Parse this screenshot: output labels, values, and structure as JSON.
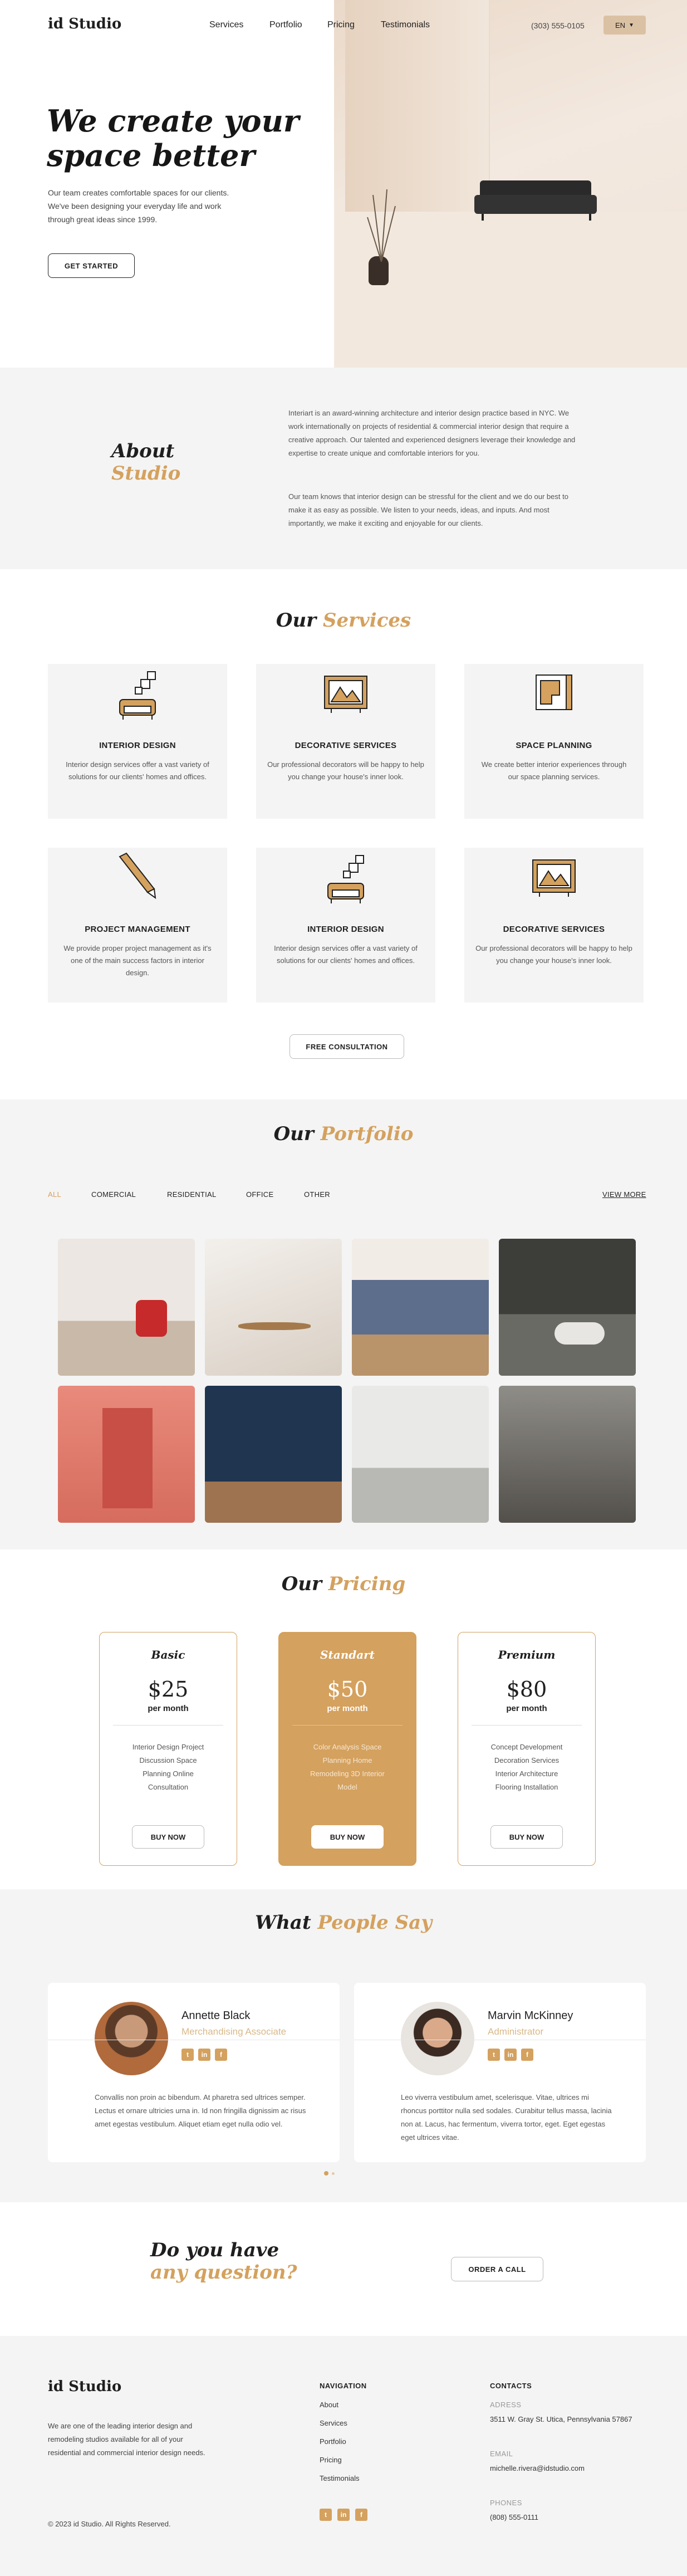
{
  "header": {
    "logo": "id Studio",
    "nav": [
      "Services",
      "Portfolio",
      "Pricing",
      "Testimonials"
    ],
    "phone": "(303) 555-0105",
    "lang": "EN"
  },
  "hero": {
    "title_line1": "We create your",
    "title_line2": "space better",
    "text": "Our team creates comfortable spaces for our clients. We've been designing your everyday life and work through great ideas since 1999.",
    "cta": "GET STARTED"
  },
  "about": {
    "title1": "About",
    "title2": "Studio",
    "p1": "Interiart is an award-winning architecture and interior design practice based in NYC. We work internationally on projects of residential & commercial interior design that require a creative approach. Our talented and experienced designers leverage their knowledge and expertise to create unique and comfortable interiors for you.",
    "p2": "Our team knows that interior design can be stressful for the client and we do our best to make it as easy as possible. We listen to your needs, ideas, and inputs. And most importantly, we make it exciting and enjoyable for our clients."
  },
  "services": {
    "title1": "Our",
    "title2": "Services",
    "cards": [
      {
        "icon": "sofa-icon",
        "title": "INTERIOR DESIGN",
        "text": "Interior design services offer a vast variety of solutions for our clients' homes and offices."
      },
      {
        "icon": "picture-frame-icon",
        "title": "DECORATIVE SERVICES",
        "text": "Our professional decorators will be happy to help you change your house's inner look."
      },
      {
        "icon": "blueprint-icon",
        "title": "SPACE PLANNING",
        "text": "We create better interior experiences through our space planning services."
      },
      {
        "icon": "pencil-icon",
        "title": "PROJECT MANAGEMENT",
        "text": "We provide proper project management as it's one of the main success factors in interior design."
      },
      {
        "icon": "sofa-icon",
        "title": "INTERIOR DESIGN",
        "text": "Interior design services offer a vast variety of solutions for our clients' homes and offices."
      },
      {
        "icon": "picture-frame-icon",
        "title": "DECORATIVE SERVICES",
        "text": "Our professional decorators will be happy to help you change your house's inner look."
      }
    ],
    "cta": "FREE CONSULTATION"
  },
  "portfolio": {
    "title1": "Our",
    "title2": "Portfolio",
    "filters": [
      "ALL",
      "COMERCIAL",
      "RESIDENTIAL",
      "OFFICE",
      "OTHER"
    ],
    "view_more": "VIEW MORE"
  },
  "pricing": {
    "title1": "Our",
    "title2": "Pricing",
    "plans": [
      {
        "name": "Basic",
        "price": "$25",
        "period": "per month",
        "features": [
          "Interior Design Project",
          "Discussion Space",
          "Planning Online",
          "Consultation"
        ],
        "button": "BUY NOW"
      },
      {
        "name": "Standart",
        "price": "$50",
        "period": "per month",
        "features": [
          "Color Analysis Space",
          "Planning Home",
          "Remodeling 3D Interior",
          "Model"
        ],
        "button": "BUY NOW"
      },
      {
        "name": "Premium",
        "price": "$80",
        "period": "per month",
        "features": [
          "Concept Development",
          "Decoration Services",
          "Interior Architecture",
          "Flooring Installation"
        ],
        "button": "BUY NOW"
      }
    ]
  },
  "testimonials": {
    "title1": "What",
    "title2": "People Say",
    "items": [
      {
        "name": "Annette Black",
        "role": "Merchandising Associate",
        "text": "Convallis non proin ac bibendum. At pharetra sed ultrices semper. Lectus et ornare ultricies urna in. Id non fringilla dignissim ac risus amet egestas vestibulum. Aliquet etiam eget nulla odio vel."
      },
      {
        "name": "Marvin McKinney",
        "role": "Administrator",
        "text": "Leo viverra vestibulum amet, scelerisque. Vitae, ultrices mi rhoncus porttitor nulla sed sodales. Curabitur tellus massa, lacinia non at. Lacus, hac fermentum, viverra tortor, eget. Eget egestas eget ultrices vitae."
      }
    ]
  },
  "question": {
    "line1": "Do you have",
    "line2": "any question?",
    "cta": "ORDER A CALL"
  },
  "footer": {
    "logo": "id Studio",
    "text": "We are one of the leading interior design and remodeling studios available for all of your residential and commercial interior design needs.",
    "copyright": "© 2023 id Studio. All Rights Reserved.",
    "nav_title": "NAVIGATION",
    "nav": [
      "About",
      "Services",
      "Portfolio",
      "Pricing",
      "Testimonials"
    ],
    "contacts_title": "CONTACTS",
    "address_label": "ADRESS",
    "address": "3511 W. Gray St. Utica, Pennsylvania 57867",
    "email_label": "EMAIL",
    "email": "michelle.rivera@idstudio.com",
    "phones_label": "PHONES",
    "phone": "(808) 555-0111"
  },
  "colors": {
    "accent": "#d4a15e",
    "light_bg": "#f4f4f4"
  }
}
